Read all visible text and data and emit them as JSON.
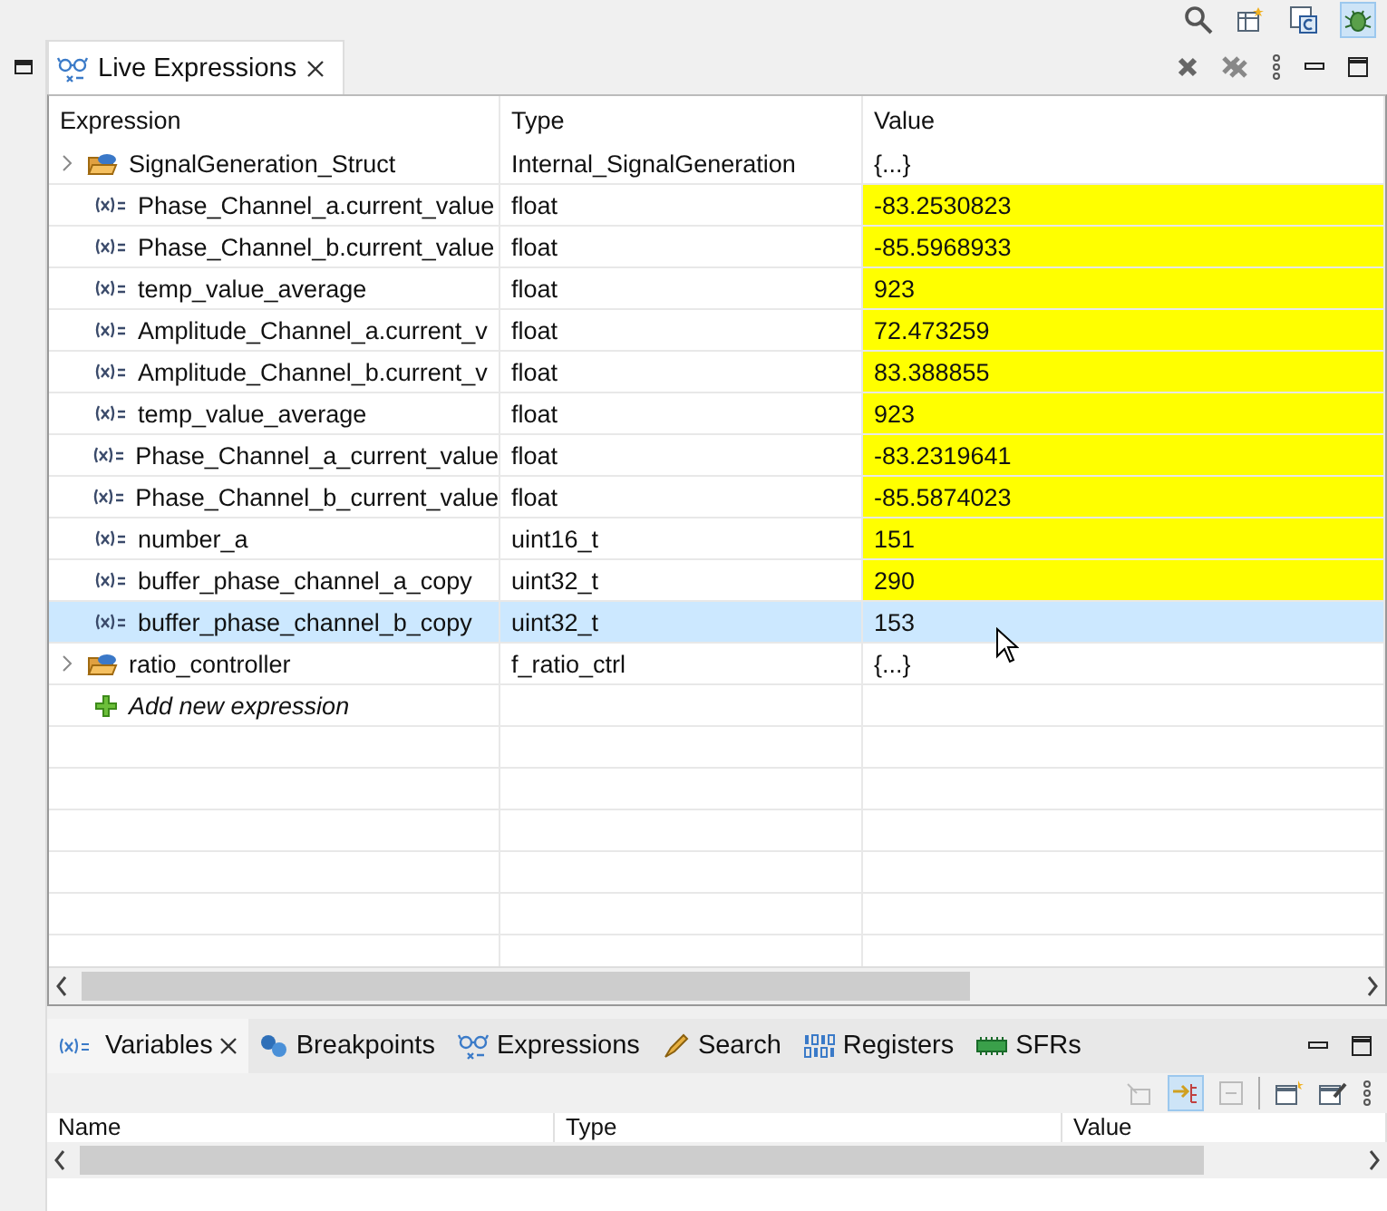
{
  "live_expressions": {
    "tab": {
      "label": "Live Expressions",
      "selected": true
    },
    "columns": [
      "Expression",
      "Type",
      "Value"
    ],
    "rows": [
      {
        "kind": "struct",
        "expression": "SignalGeneration_Struct",
        "type": "Internal_SignalGeneration",
        "value": "{...}",
        "changed": false,
        "selected": false
      },
      {
        "kind": "variable",
        "expression": "Phase_Channel_a.current_value",
        "type": "float",
        "value": "-83.2530823",
        "changed": true,
        "selected": false
      },
      {
        "kind": "variable",
        "expression": "Phase_Channel_b.current_value",
        "type": "float",
        "value": "-85.5968933",
        "changed": true,
        "selected": false
      },
      {
        "kind": "variable",
        "expression": "temp_value_average",
        "type": "float",
        "value": "923",
        "changed": true,
        "selected": false
      },
      {
        "kind": "variable",
        "expression": "Amplitude_Channel_a.current_v",
        "type": "float",
        "value": "72.473259",
        "changed": true,
        "selected": false
      },
      {
        "kind": "variable",
        "expression": "Amplitude_Channel_b.current_v",
        "type": "float",
        "value": "83.388855",
        "changed": true,
        "selected": false
      },
      {
        "kind": "variable",
        "expression": "temp_value_average",
        "type": "float",
        "value": "923",
        "changed": true,
        "selected": false
      },
      {
        "kind": "variable",
        "expression": "Phase_Channel_a_current_value",
        "type": "float",
        "value": "-83.2319641",
        "changed": true,
        "selected": false
      },
      {
        "kind": "variable",
        "expression": "Phase_Channel_b_current_value",
        "type": "float",
        "value": "-85.5874023",
        "changed": true,
        "selected": false
      },
      {
        "kind": "variable",
        "expression": "number_a",
        "type": "uint16_t",
        "value": "151",
        "changed": true,
        "selected": false
      },
      {
        "kind": "variable",
        "expression": "buffer_phase_channel_a_copy",
        "type": "uint32_t",
        "value": "290",
        "changed": true,
        "selected": false
      },
      {
        "kind": "variable",
        "expression": "buffer_phase_channel_b_copy",
        "type": "uint32_t",
        "value": "153",
        "changed": false,
        "selected": true
      },
      {
        "kind": "struct",
        "expression": "ratio_controller",
        "type": "f_ratio_ctrl",
        "value": "{...}",
        "changed": false,
        "selected": false
      },
      {
        "kind": "add",
        "expression": "Add new expression"
      }
    ]
  },
  "bottom_tabs": [
    {
      "kind": "variable",
      "label": "Variables",
      "selected": true
    },
    {
      "kind": "breakpoint",
      "label": "Breakpoints",
      "selected": false
    },
    {
      "kind": "glasses",
      "label": "Expressions",
      "selected": false
    },
    {
      "kind": "search",
      "label": "Search",
      "selected": false
    },
    {
      "kind": "binary",
      "label": "Registers",
      "selected": false
    },
    {
      "kind": "chip",
      "label": "SFRs",
      "selected": false
    }
  ],
  "variables_columns": [
    "Name",
    "Type",
    "Value"
  ]
}
